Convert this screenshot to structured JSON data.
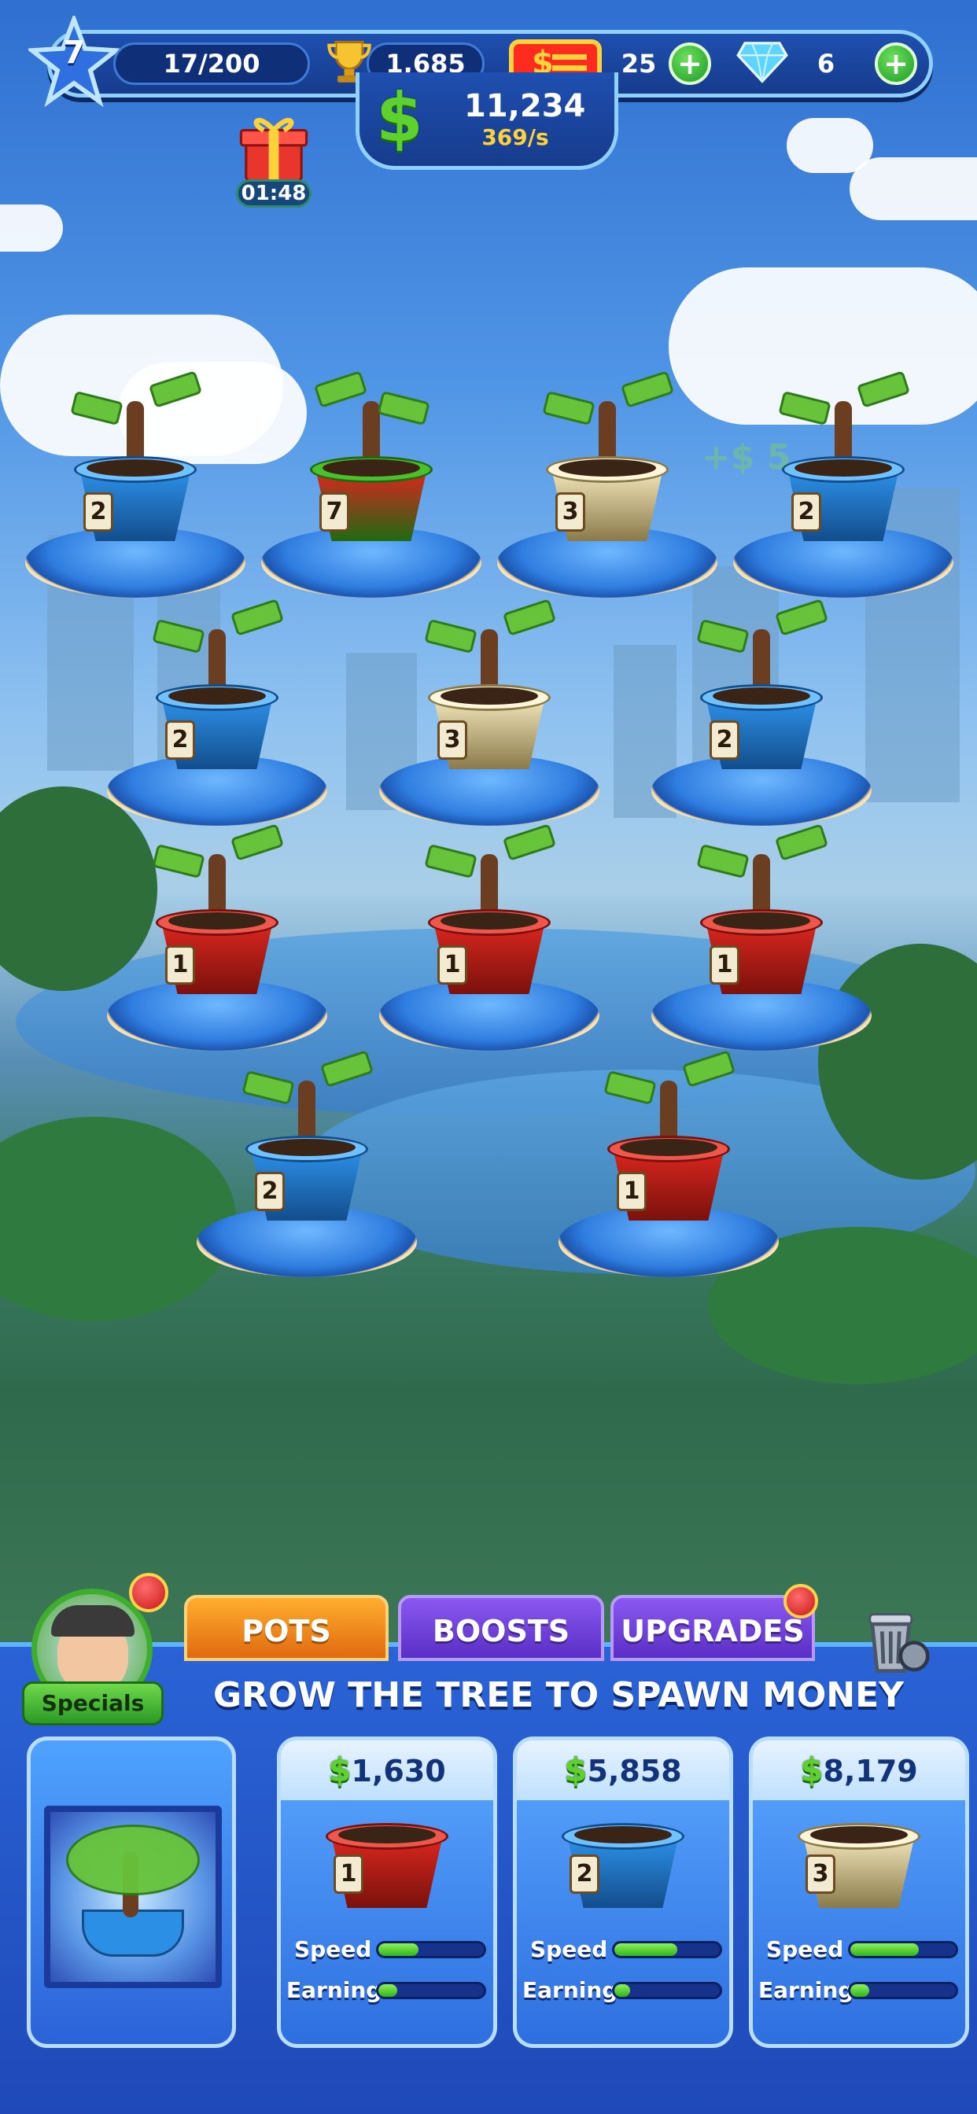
{
  "hud": {
    "level": "7",
    "xp": "17/200",
    "trophies": "1,685",
    "tickets": "25",
    "gems": "6",
    "money": "11,234",
    "money_rate": "369/s",
    "gift_timer": "01:48"
  },
  "floating_text": [
    "+$ 5"
  ],
  "field_pots": [
    {
      "level": "2",
      "color": "blue"
    },
    {
      "level": "7",
      "color": "red-green"
    },
    {
      "level": "3",
      "color": "cream"
    },
    {
      "level": "2",
      "color": "blue"
    },
    {
      "level": "2",
      "color": "blue"
    },
    {
      "level": "3",
      "color": "cream"
    },
    {
      "level": "2",
      "color": "blue"
    },
    {
      "level": "1",
      "color": "red"
    },
    {
      "level": "1",
      "color": "red"
    },
    {
      "level": "1",
      "color": "red"
    },
    {
      "level": "2",
      "color": "blue"
    },
    {
      "level": "1",
      "color": "red"
    }
  ],
  "bottom": {
    "specials_label": "Specials",
    "tabs": [
      {
        "label": "POTS",
        "active": true
      },
      {
        "label": "BOOSTS",
        "active": false
      },
      {
        "label": "UPGRADES",
        "active": false
      }
    ],
    "section_title": "GROW THE TREE TO SPAWN MONEY",
    "shop_items": [
      {
        "price": "1,630",
        "level": "1",
        "color": "red",
        "speed": 0.38,
        "earning": 0.18
      },
      {
        "price": "5,858",
        "level": "2",
        "color": "blue",
        "speed": 0.6,
        "earning": 0.15
      },
      {
        "price": "8,179",
        "level": "3",
        "color": "cream",
        "speed": 0.65,
        "earning": 0.18
      }
    ],
    "speed_label": "Speed",
    "earning_label": "Earning"
  },
  "colors": {
    "pot_red": "#d8261e",
    "pot_blue": "#2c8fe6",
    "pot_cream": "#efe3b8",
    "pot_green_rim": "#4cc02a",
    "accent_orange": "#f08a1a",
    "accent_purple": "#6b3fd8"
  }
}
